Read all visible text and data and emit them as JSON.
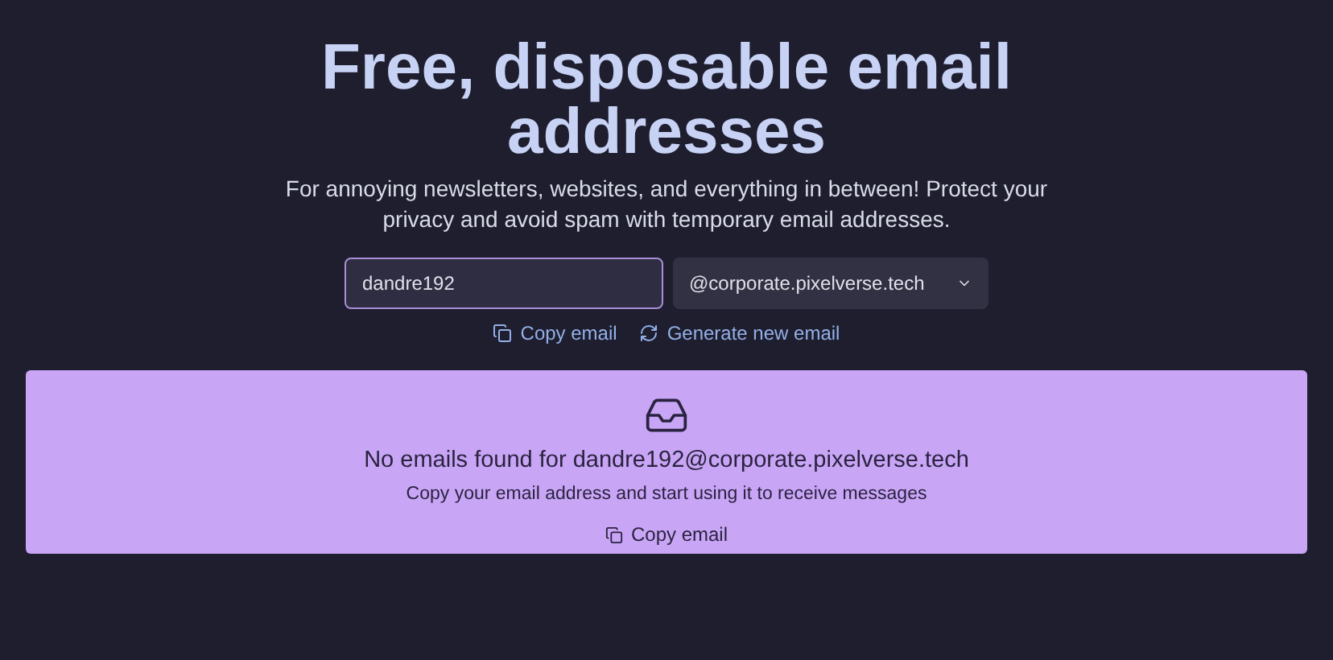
{
  "hero": {
    "title": "Free, disposable email addresses",
    "subtitle": "For annoying newsletters, websites, and everything in between! Protect your privacy and avoid spam with temporary email addresses."
  },
  "form": {
    "username": "dandre192",
    "domain": "@corporate.pixelverse.tech"
  },
  "actions": [
    {
      "kind": "copy",
      "label": "Copy email"
    },
    {
      "kind": "refresh",
      "label": "Generate new email"
    }
  ],
  "inbox": {
    "message": "No emails found for dandre192@corporate.pixelverse.tech",
    "hint": "Copy your email address and start using it to receive messages",
    "button": "Copy email"
  }
}
